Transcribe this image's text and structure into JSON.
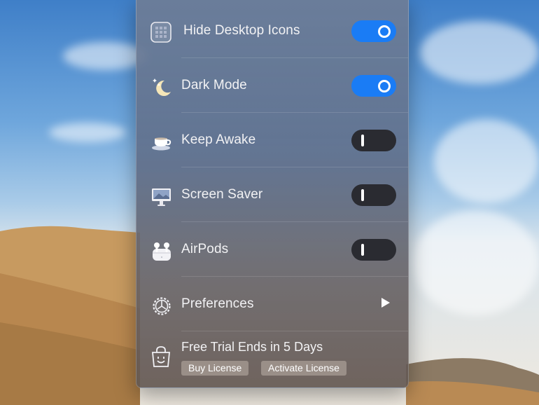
{
  "menu": {
    "items": [
      {
        "label": "Hide Desktop Icons",
        "icon": "grid-icon",
        "state": "on"
      },
      {
        "label": "Dark Mode",
        "icon": "moon-stars-icon",
        "state": "on"
      },
      {
        "label": "Keep Awake",
        "icon": "coffee-cup-icon",
        "state": "off"
      },
      {
        "label": "Screen Saver",
        "icon": "monitor-icon",
        "state": "off"
      },
      {
        "label": "AirPods",
        "icon": "airpods-icon",
        "state": "off"
      },
      {
        "label": "Preferences",
        "icon": "gear-icon",
        "state": "submenu"
      }
    ],
    "trial": {
      "label": "Free Trial Ends in 5 Days",
      "icon": "shopping-bag-icon",
      "buy_label": "Buy License",
      "activate_label": "Activate License"
    }
  },
  "colors": {
    "toggle_on": "#1a7cf5",
    "toggle_off": "#2a2b31",
    "chip": "#9a8f88"
  }
}
